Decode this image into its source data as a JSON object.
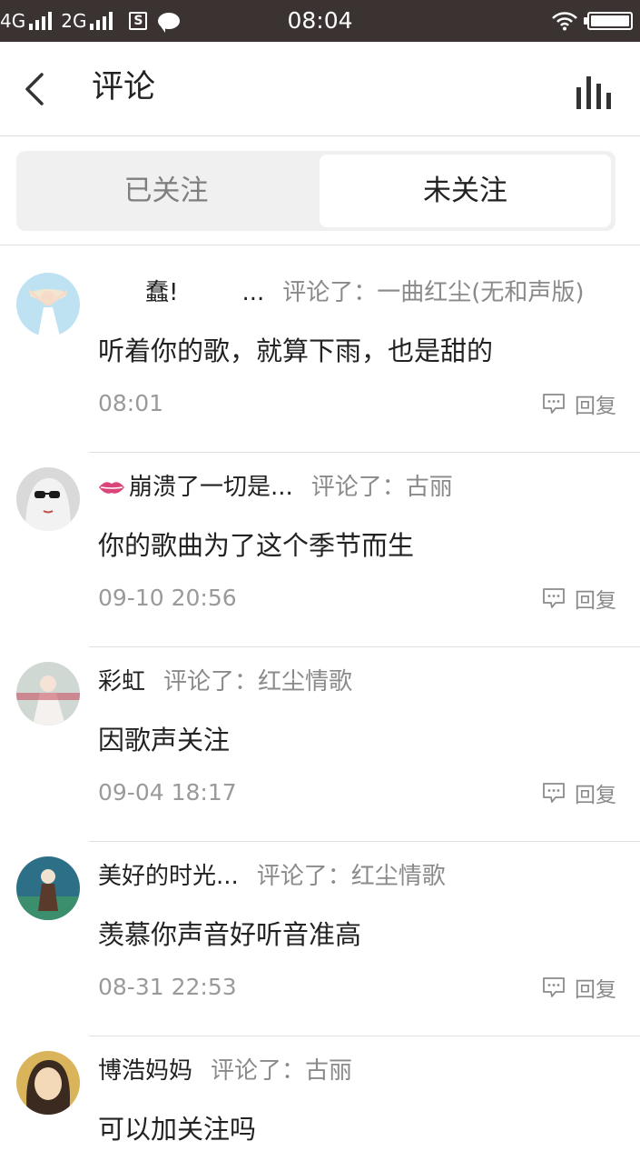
{
  "status_bar": {
    "network_1": "4G",
    "network_2": "2G",
    "time": "08:04"
  },
  "header": {
    "title": "评论"
  },
  "tabs": [
    {
      "label": "已关注",
      "selected": false
    },
    {
      "label": "未关注",
      "selected": true
    }
  ],
  "comments": [
    {
      "username": "蠢!",
      "username_suffix": "...",
      "action": "评论了：一曲红尘(无和声版)",
      "body": "听着你的歌，就算下雨，也是甜的",
      "time": "08:01",
      "reply_label": "回复",
      "avatar_colors": [
        "#bfe2f2",
        "#f3e6cf",
        "#ffffff"
      ]
    },
    {
      "username": "崩溃了一切是...",
      "action": "评论了：古丽",
      "body": "你的歌曲为了这个季节而生",
      "time": "09-10 20:56",
      "reply_label": "回复",
      "avatar_colors": [
        "#d9d9d9",
        "#1a1a1a",
        "#f2f2f2"
      ]
    },
    {
      "username": "彩虹",
      "action": "评论了：红尘情歌",
      "body": "因歌声关注",
      "time": "09-04 18:17",
      "reply_label": "回复",
      "avatar_colors": [
        "#cfd8d2",
        "#f4f1ee",
        "#c8475a"
      ]
    },
    {
      "username": "美好的时光...",
      "action": "评论了：红尘情歌",
      "body": "羡慕你声音好听音准高",
      "time": "08-31 22:53",
      "reply_label": "回复",
      "avatar_colors": [
        "#2d6f86",
        "#3b8f6d",
        "#efe2cf"
      ]
    },
    {
      "username": "博浩妈妈",
      "action": "评论了：古丽",
      "body": "可以加关注吗",
      "time": "",
      "reply_label": "",
      "avatar_colors": [
        "#d9b45a",
        "#f3d9b8",
        "#3a2a20"
      ]
    }
  ],
  "colors": {
    "status_bar_bg": "#3a3331",
    "lips": "#d9447a"
  }
}
